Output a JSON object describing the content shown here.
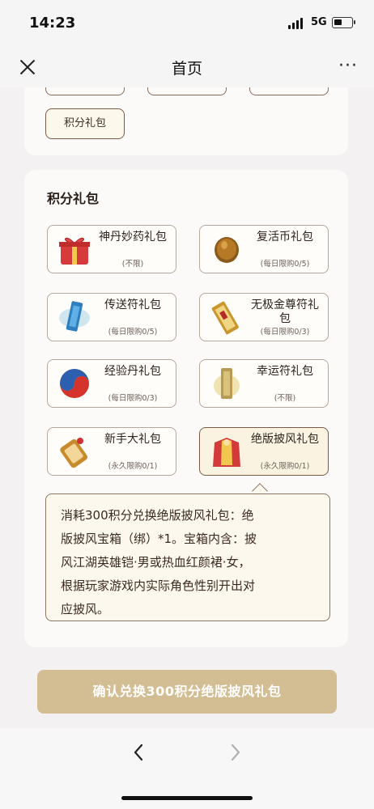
{
  "status": {
    "time": "14:23",
    "network": "5G"
  },
  "nav": {
    "title": "首页",
    "more": "···"
  },
  "top_card": {
    "chip_label": "积分礼包"
  },
  "section": {
    "title": "积分礼包",
    "packs": [
      {
        "name": "神丹妙药礼包",
        "limit": "(不限)",
        "icon": "red-gift-box-icon"
      },
      {
        "name": "复活币礼包",
        "limit": "(每日限购0/5)",
        "icon": "gold-coin-icon"
      },
      {
        "name": "传送符礼包",
        "limit": "(每日限购0/5)",
        "icon": "teleport-talisman-icon"
      },
      {
        "name": "无极金尊符礼包",
        "limit": "(每日限购0/3)",
        "icon": "gold-talisman-icon"
      },
      {
        "name": "经验丹礼包",
        "limit": "(每日限购0/3)",
        "icon": "experience-pill-icon"
      },
      {
        "name": "幸运符礼包",
        "limit": "(不限)",
        "icon": "luck-talisman-icon"
      },
      {
        "name": "新手大礼包",
        "limit": "(永久限购0/1)",
        "icon": "newbie-token-icon"
      },
      {
        "name": "绝版披风礼包",
        "limit": "(永久限购0/1)",
        "icon": "cape-icon"
      }
    ],
    "tooltip_lines": [
      "消耗300积分兑换绝版披风礼包：绝",
      "版披风宝箱（绑）*1。宝箱内含：披",
      "风江湖英雄铠·男或热血红颜裙·女，",
      "根据玩家游戏内实际角色性别开出对",
      "应披风。"
    ]
  },
  "confirm_button": "确认兑换300积分绝版披风礼包"
}
